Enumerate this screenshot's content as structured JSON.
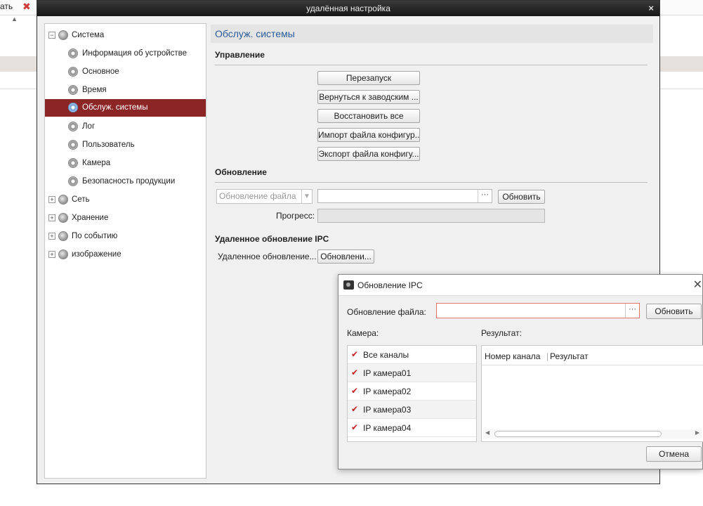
{
  "background": {
    "top_label": "ать",
    "top_second": "ⓞ"
  },
  "window": {
    "title": "удалённая настройка",
    "close": "×"
  },
  "tree": {
    "root": "Система",
    "children": [
      "Информация об устройстве",
      "Основное",
      "Время",
      "Обслуж. системы",
      "Лог",
      "Пользователь",
      "Камера",
      "Безопасность продукции"
    ],
    "groups": [
      "Сеть",
      "Хранение",
      "По событию",
      "изображение"
    ]
  },
  "content": {
    "section_title": "Обслуж. системы",
    "management_title": "Управление",
    "buttons": [
      "Перезапуск",
      "Вернуться к заводским ...",
      "Восстановить все",
      "Импорт файла конфигур...",
      "Экспорт файла конфигу..."
    ],
    "update_title": "Обновление",
    "file_select": "Обновление файла",
    "update_button": "Обновить",
    "progress_label": "Прогресс:",
    "remote_title": "Удаленное обновление IPC",
    "remote_label": "Удаленное обновление...",
    "remote_button": "Обновлени..."
  },
  "dialog": {
    "title": "Обновление IPC",
    "file_label": "Обновление файла:",
    "update_button": "Обновить",
    "camera_label": "Камера:",
    "result_label": "Результат:",
    "cameras": [
      {
        "label": "Все каналы",
        "checked": true
      },
      {
        "label": "IP камера01",
        "checked": true
      },
      {
        "label": "IP камера02",
        "checked": true
      },
      {
        "label": "IP камера03",
        "checked": true
      },
      {
        "label": "IP камера04",
        "checked": true
      }
    ],
    "result_columns": [
      "Номер канала",
      "Результат"
    ],
    "cancel_button": "Отмена"
  }
}
